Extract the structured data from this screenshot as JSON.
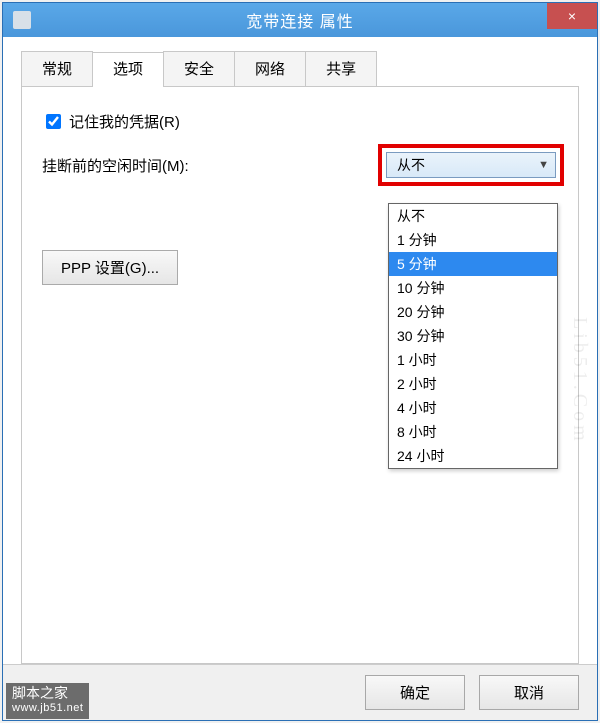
{
  "window": {
    "title": "宽带连接 属性",
    "close_label": "×"
  },
  "tabs": {
    "t0": "常规",
    "t1": "选项",
    "t2": "安全",
    "t3": "网络",
    "t4": "共享"
  },
  "options": {
    "remember_checkbox_label": "记住我的凭据(R)",
    "idle_label": "挂断前的空闲时间(M):",
    "idle_selected": "从不",
    "ppp_button": "PPP 设置(G)..."
  },
  "idle_options": {
    "o0": "从不",
    "o1": "1 分钟",
    "o2": "5 分钟",
    "o3": "10 分钟",
    "o4": "20 分钟",
    "o5": "30 分钟",
    "o6": "1 小时",
    "o7": "2 小时",
    "o8": "4 小时",
    "o9": "8 小时",
    "o10": "24 小时"
  },
  "buttons": {
    "ok": "确定",
    "cancel": "取消"
  },
  "watermark": {
    "side": "Lib51.Com",
    "name": "脚本之家",
    "url": "www.jb51.net"
  }
}
